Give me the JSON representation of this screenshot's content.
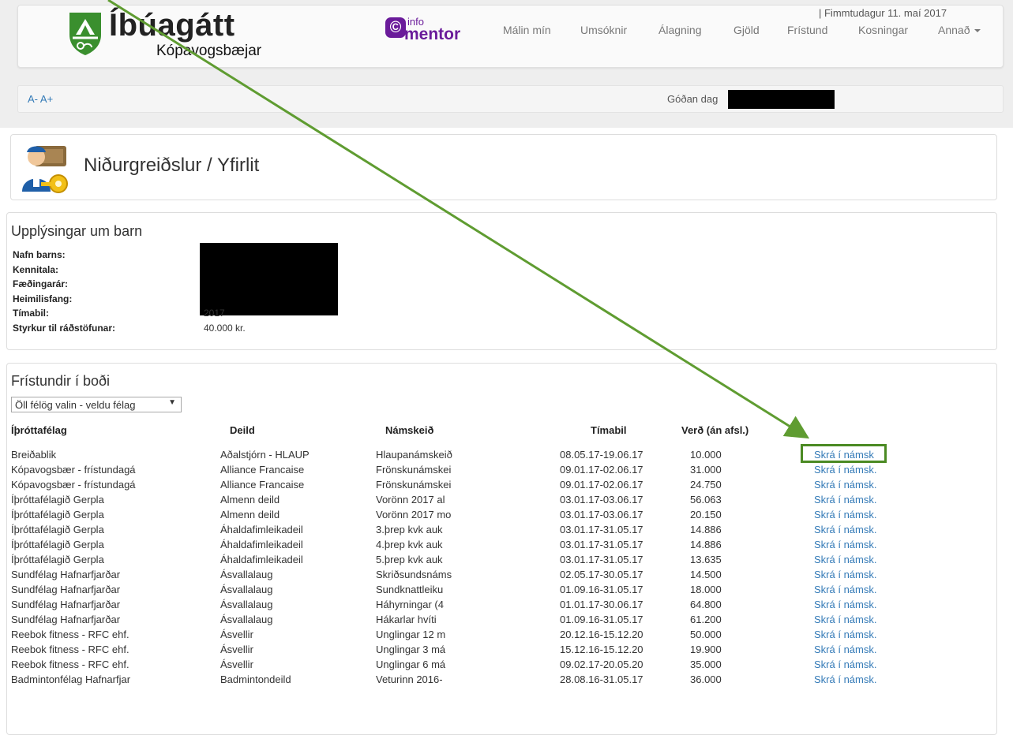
{
  "colors": {
    "link": "#337ab7",
    "brand_green": "#3a8f2e",
    "infomentor_purple": "#6a1b9a",
    "arrow_green": "#5f9c31"
  },
  "brand": {
    "title": "Íbúagátt",
    "subtitle": "Kópavogsbæjar",
    "logo_icon": "kopavogur-shield-icon"
  },
  "infomentor": {
    "small": "info",
    "big": "mentor",
    "icon": "infomentor-icon"
  },
  "nav": {
    "items": [
      "Málin mín",
      "Umsóknir",
      "Álagning",
      "Gjöld",
      "Frístund",
      "Kosningar",
      "Annað"
    ]
  },
  "subbar": {
    "font_controls": "A- A+",
    "greeting": "Góðan dag",
    "date": "| Fimmtudagur 11. maí 2017"
  },
  "page": {
    "title": "Niðurgreiðslur / Yfirlit",
    "avatar": "user-key-icon"
  },
  "child_info": {
    "heading": "Upplýsingar um barn",
    "labels": [
      "Nafn barns:",
      "Kennitala:",
      "Fæðingarár:",
      "Heimilisfang:",
      "Tímabil:",
      "Styrkur til ráðstöfunar:"
    ],
    "period_value": "2017",
    "grant_value": "40.000 kr."
  },
  "activities": {
    "heading": "Frístundir í boði",
    "filter_selected": "Öll félög valin - veldu félag",
    "columns": [
      "Íþróttafélag",
      "Deild",
      "Námskeið",
      "Tímabil",
      "Verð (án afsl.)"
    ],
    "rows": [
      {
        "club": "Breiðablik",
        "dept": "Aðalstjórn - HLAUP",
        "course": "Hlaupanámskeið",
        "period": "08.05.17-19.06.17",
        "price": "10.000",
        "link": "Skrá í námsk"
      },
      {
        "club": "Kópavogsbær - frístundagá",
        "dept": "Alliance Francaise",
        "course": "Frönskunámskei",
        "period": "09.01.17-02.06.17",
        "price": "31.000",
        "link": "Skrá í námsk."
      },
      {
        "club": "Kópavogsbær - frístundagá",
        "dept": "Alliance Francaise",
        "course": "Frönskunámskei",
        "period": "09.01.17-02.06.17",
        "price": "24.750",
        "link": "Skrá í námsk."
      },
      {
        "club": "Íþróttafélagið Gerpla",
        "dept": "Almenn deild",
        "course": "Vorönn 2017 al",
        "period": "03.01.17-03.06.17",
        "price": "56.063",
        "link": "Skrá í námsk."
      },
      {
        "club": "Íþróttafélagið Gerpla",
        "dept": "Almenn deild",
        "course": "Vorönn 2017 mo",
        "period": "03.01.17-03.06.17",
        "price": "20.150",
        "link": "Skrá í námsk."
      },
      {
        "club": "Íþróttafélagið Gerpla",
        "dept": "Áhaldafimleikadeil",
        "course": "3.þrep kvk auk",
        "period": "03.01.17-31.05.17",
        "price": "14.886",
        "link": "Skrá í námsk."
      },
      {
        "club": "Íþróttafélagið Gerpla",
        "dept": "Áhaldafimleikadeil",
        "course": "4.þrep kvk auk",
        "period": "03.01.17-31.05.17",
        "price": "14.886",
        "link": "Skrá í námsk."
      },
      {
        "club": "Íþróttafélagið Gerpla",
        "dept": "Áhaldafimleikadeil",
        "course": "5.þrep kvk auk",
        "period": "03.01.17-31.05.17",
        "price": "13.635",
        "link": "Skrá í námsk."
      },
      {
        "club": "Sundfélag Hafnarfjarðar",
        "dept": "Ásvallalaug",
        "course": "Skriðsundsnáms",
        "period": "02.05.17-30.05.17",
        "price": "14.500",
        "link": "Skrá í námsk."
      },
      {
        "club": "Sundfélag Hafnarfjarðar",
        "dept": "Ásvallalaug",
        "course": "Sundknattleiku",
        "period": "01.09.16-31.05.17",
        "price": "18.000",
        "link": "Skrá í námsk."
      },
      {
        "club": "Sundfélag Hafnarfjarðar",
        "dept": "Ásvallalaug",
        "course": "Háhyrningar (4",
        "period": "01.01.17-30.06.17",
        "price": "64.800",
        "link": "Skrá í námsk."
      },
      {
        "club": "Sundfélag Hafnarfjarðar",
        "dept": "Ásvallalaug",
        "course": "Hákarlar hvíti",
        "period": "01.09.16-31.05.17",
        "price": "61.200",
        "link": "Skrá í námsk."
      },
      {
        "club": "Reebok fitness - RFC ehf.",
        "dept": "Ásvellir",
        "course": "Unglingar 12 m",
        "period": "20.12.16-15.12.20",
        "price": "50.000",
        "link": "Skrá í námsk."
      },
      {
        "club": "Reebok fitness - RFC ehf.",
        "dept": "Ásvellir",
        "course": "Unglingar 3 má",
        "period": "15.12.16-15.12.20",
        "price": "19.900",
        "link": "Skrá í námsk."
      },
      {
        "club": "Reebok fitness - RFC ehf.",
        "dept": "Ásvellir",
        "course": "Unglingar 6 má",
        "period": "09.02.17-20.05.20",
        "price": "35.000",
        "link": "Skrá í námsk."
      },
      {
        "club": "Badmintonfélag Hafnarfjar",
        "dept": "Badmintondeild",
        "course": "Veturinn 2016-",
        "period": "28.08.16-31.05.17",
        "price": "36.000",
        "link": "Skrá í námsk."
      }
    ]
  }
}
